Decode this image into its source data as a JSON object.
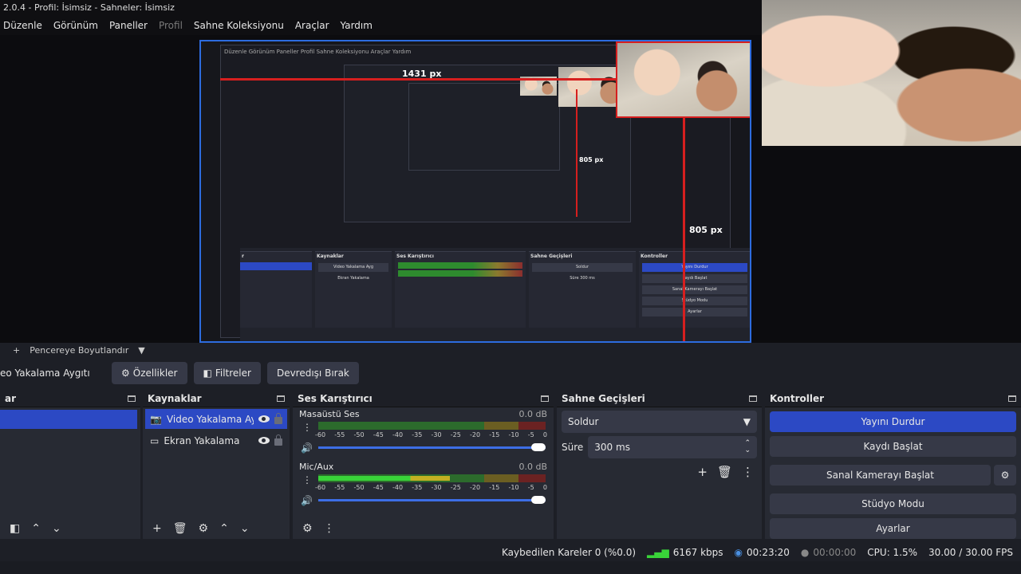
{
  "window": {
    "title": "2.0.4 - Profil: İsimsiz - Sahneler: İsimsiz"
  },
  "menu": [
    "Düzenle",
    "Görünüm",
    "Paneller",
    "Profil",
    "Sahne Koleksiyonu",
    "Araçlar",
    "Yardım"
  ],
  "preview": {
    "label_horizontal": "1431 px",
    "label_vertical_1": "805 px",
    "label_vertical_2": "805 px"
  },
  "scene_toolbar": {
    "add": "+",
    "resize_label": "Pencereye Boyutlandır"
  },
  "source_toolbar": {
    "source_name": "eo Yakalama Aygıtı",
    "properties": "Özellikler",
    "filters": "Filtreler",
    "deactivate": "Devredışı Bırak"
  },
  "scenes_dock": {
    "title": "ar"
  },
  "sources_dock": {
    "title": "Kaynaklar",
    "items": [
      {
        "label": "Video Yakalama Ayg",
        "icon": "camera-icon"
      },
      {
        "label": "Ekran Yakalama",
        "icon": "monitor-icon"
      }
    ]
  },
  "mixer_dock": {
    "title": "Ses Karıştırıcı",
    "channels": [
      {
        "name": "Masaüstü Ses",
        "db": "0.0 dB",
        "level": 0
      },
      {
        "name": "Mic/Aux",
        "db": "0.0 dB",
        "level": 0.58
      }
    ],
    "ticks": [
      "-60",
      "-55",
      "-50",
      "-45",
      "-40",
      "-35",
      "-30",
      "-25",
      "-20",
      "-15",
      "-10",
      "-5",
      "0"
    ]
  },
  "transitions_dock": {
    "title": "Sahne Geçişleri",
    "selected": "Soldur",
    "duration_label": "Süre",
    "duration_value": "300 ms"
  },
  "controls_dock": {
    "title": "Kontroller",
    "stop_stream": "Yayını Durdur",
    "start_record": "Kaydı Başlat",
    "virtual_cam": "Sanal Kamerayı Başlat",
    "studio_mode": "Stüdyo Modu",
    "settings": "Ayarlar"
  },
  "status": {
    "dropped": "Kaybedilen Kareler 0 (%0.0)",
    "bitrate": "6167 kbps",
    "live_time": "00:23:20",
    "rec_time": "00:00:00",
    "cpu": "CPU: 1.5%",
    "fps": "30.00 / 30.00 FPS"
  },
  "colors": {
    "accent": "#2c49c4",
    "bg": "#1d1f26",
    "panel": "#272a33",
    "button": "#363947"
  }
}
